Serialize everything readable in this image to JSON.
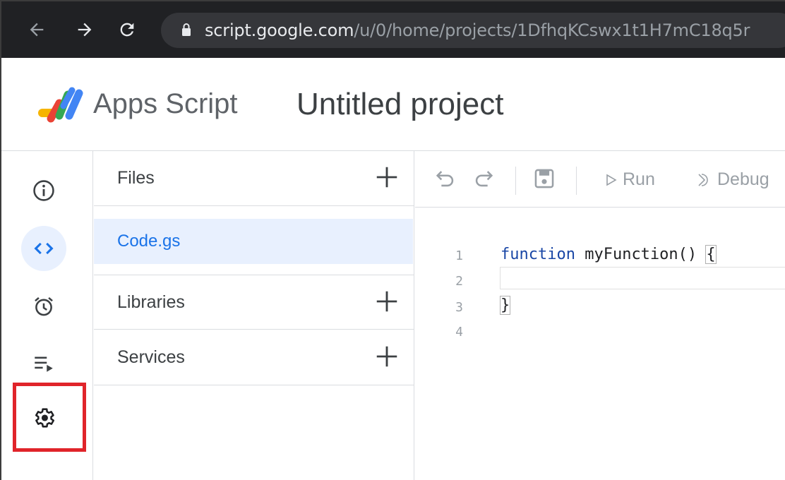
{
  "browser": {
    "url_host": "script.google.com",
    "url_path": "/u/0/home/projects/1DfhqKCswx1t1H7mC18q5r",
    "icons": [
      "back-arrow-icon",
      "forward-arrow-icon",
      "reload-icon",
      "lock-icon"
    ]
  },
  "header": {
    "app_name": "Apps Script",
    "project_title": "Untitled project",
    "logo_icon": "apps-script-logo"
  },
  "rail": {
    "items": [
      {
        "icon": "info-icon",
        "label": "Overview"
      },
      {
        "icon": "code-icon",
        "label": "Editor",
        "active": true
      },
      {
        "icon": "alarm-clock-icon",
        "label": "Triggers"
      },
      {
        "icon": "executions-icon",
        "label": "Executions"
      },
      {
        "icon": "gear-icon",
        "label": "Project Settings",
        "highlighted": true
      }
    ]
  },
  "files_panel": {
    "files_label": "Files",
    "file_name": "Code.gs",
    "libraries_label": "Libraries",
    "services_label": "Services"
  },
  "toolbar": {
    "run_label": "Run",
    "debug_label": "Debug"
  },
  "editor": {
    "line_numbers": [
      "1",
      "2",
      "3",
      "4"
    ],
    "code": {
      "line1_keyword": "function",
      "line1_rest": " myFunction() ",
      "line1_brace": "{",
      "line3_brace": "}"
    }
  },
  "colors": {
    "accent": "#1a73e8",
    "highlight_border": "#e0242a",
    "active_bg": "#e8f0fe",
    "browser_bg": "#202124"
  }
}
